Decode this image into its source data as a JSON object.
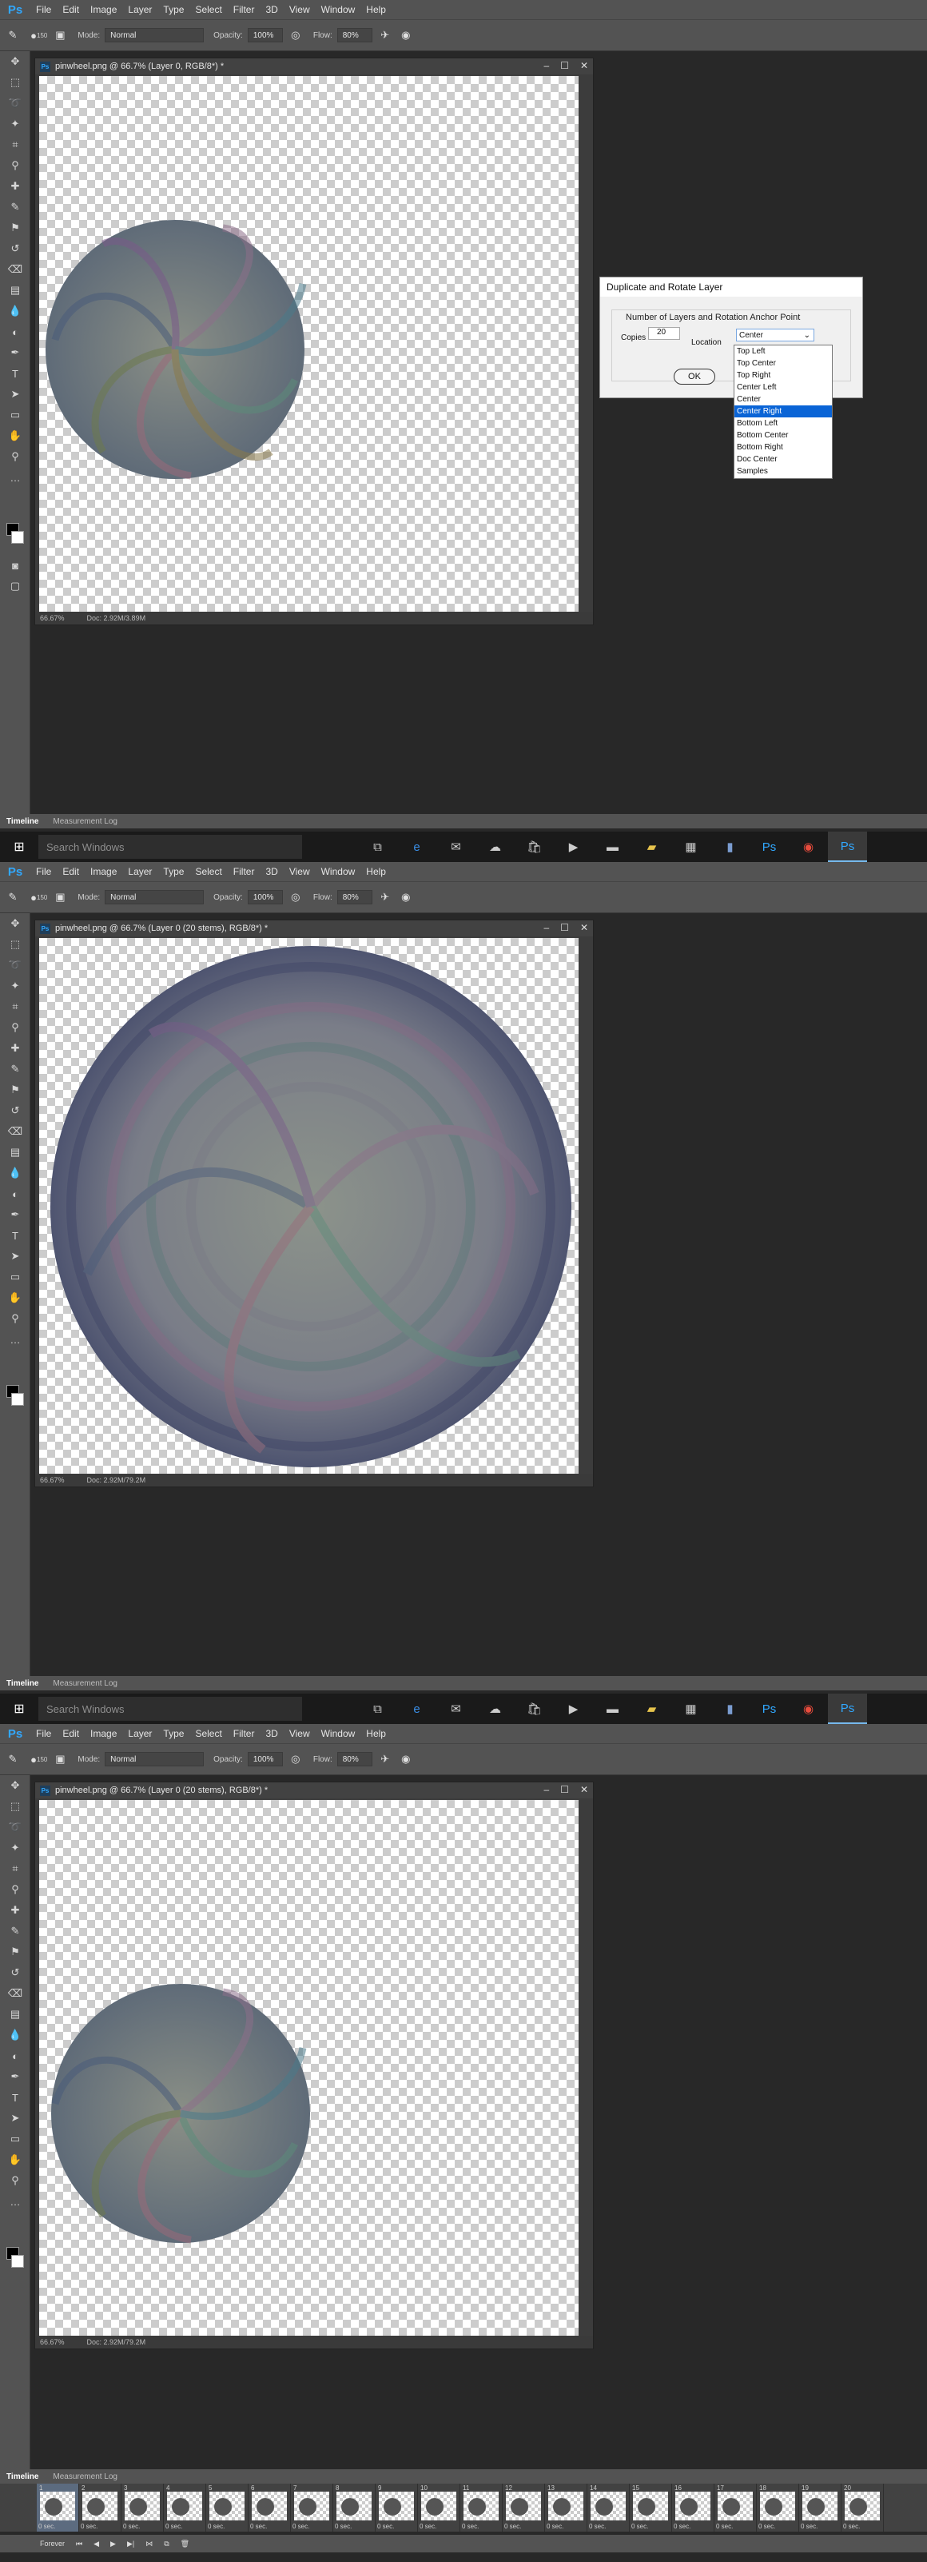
{
  "app": {
    "logo": "Ps"
  },
  "menu": [
    "File",
    "Edit",
    "Image",
    "Layer",
    "Type",
    "Select",
    "Filter",
    "3D",
    "View",
    "Window",
    "Help"
  ],
  "options": {
    "mode_label": "Mode:",
    "mode_value": "Normal",
    "opacity_label": "Opacity:",
    "opacity_value": "100%",
    "flow_label": "Flow:",
    "flow_value": "80%",
    "brush_size": "150"
  },
  "panels": [
    {
      "doc_title": "pinwheel.png @ 66.7% (Layer 0, RGB/8*) *",
      "zoom": "66.67%",
      "doc_size": "Doc: 2.92M/3.89M"
    },
    {
      "doc_title": "pinwheel.png @ 66.7% (Layer 0 (20 stems), RGB/8*) *",
      "zoom": "66.67%",
      "doc_size": "Doc: 2.92M/79.2M"
    },
    {
      "doc_title": "pinwheel.png @ 66.7% (Layer 0 (20 stems), RGB/8*) *",
      "zoom": "66.67%",
      "doc_size": "Doc: 2.92M/79.2M"
    }
  ],
  "timeline_tabs": [
    "Timeline",
    "Measurement Log"
  ],
  "taskbar": {
    "search_placeholder": "Search Windows"
  },
  "dialog": {
    "title": "Duplicate and Rotate Layer",
    "group_label": "Number of Layers and Rotation Anchor Point",
    "copies_label": "Copies",
    "copies_value": "20",
    "location_label": "Location",
    "location_value": "Center",
    "ok_label": "OK",
    "options": [
      "Top Left",
      "Top Center",
      "Top Right",
      "Center Left",
      "Center",
      "Center Right",
      "Bottom Left",
      "Bottom Center",
      "Bottom Right",
      "Doc Center",
      "Samples"
    ],
    "highlighted": "Center Right"
  },
  "frames": {
    "numbers": [
      "1",
      "2",
      "3",
      "4",
      "5",
      "6",
      "7",
      "8",
      "9",
      "10",
      "11",
      "12",
      "13",
      "14",
      "15",
      "16",
      "17",
      "18",
      "19",
      "20"
    ],
    "delay": "0 sec.",
    "loop": "Forever"
  }
}
